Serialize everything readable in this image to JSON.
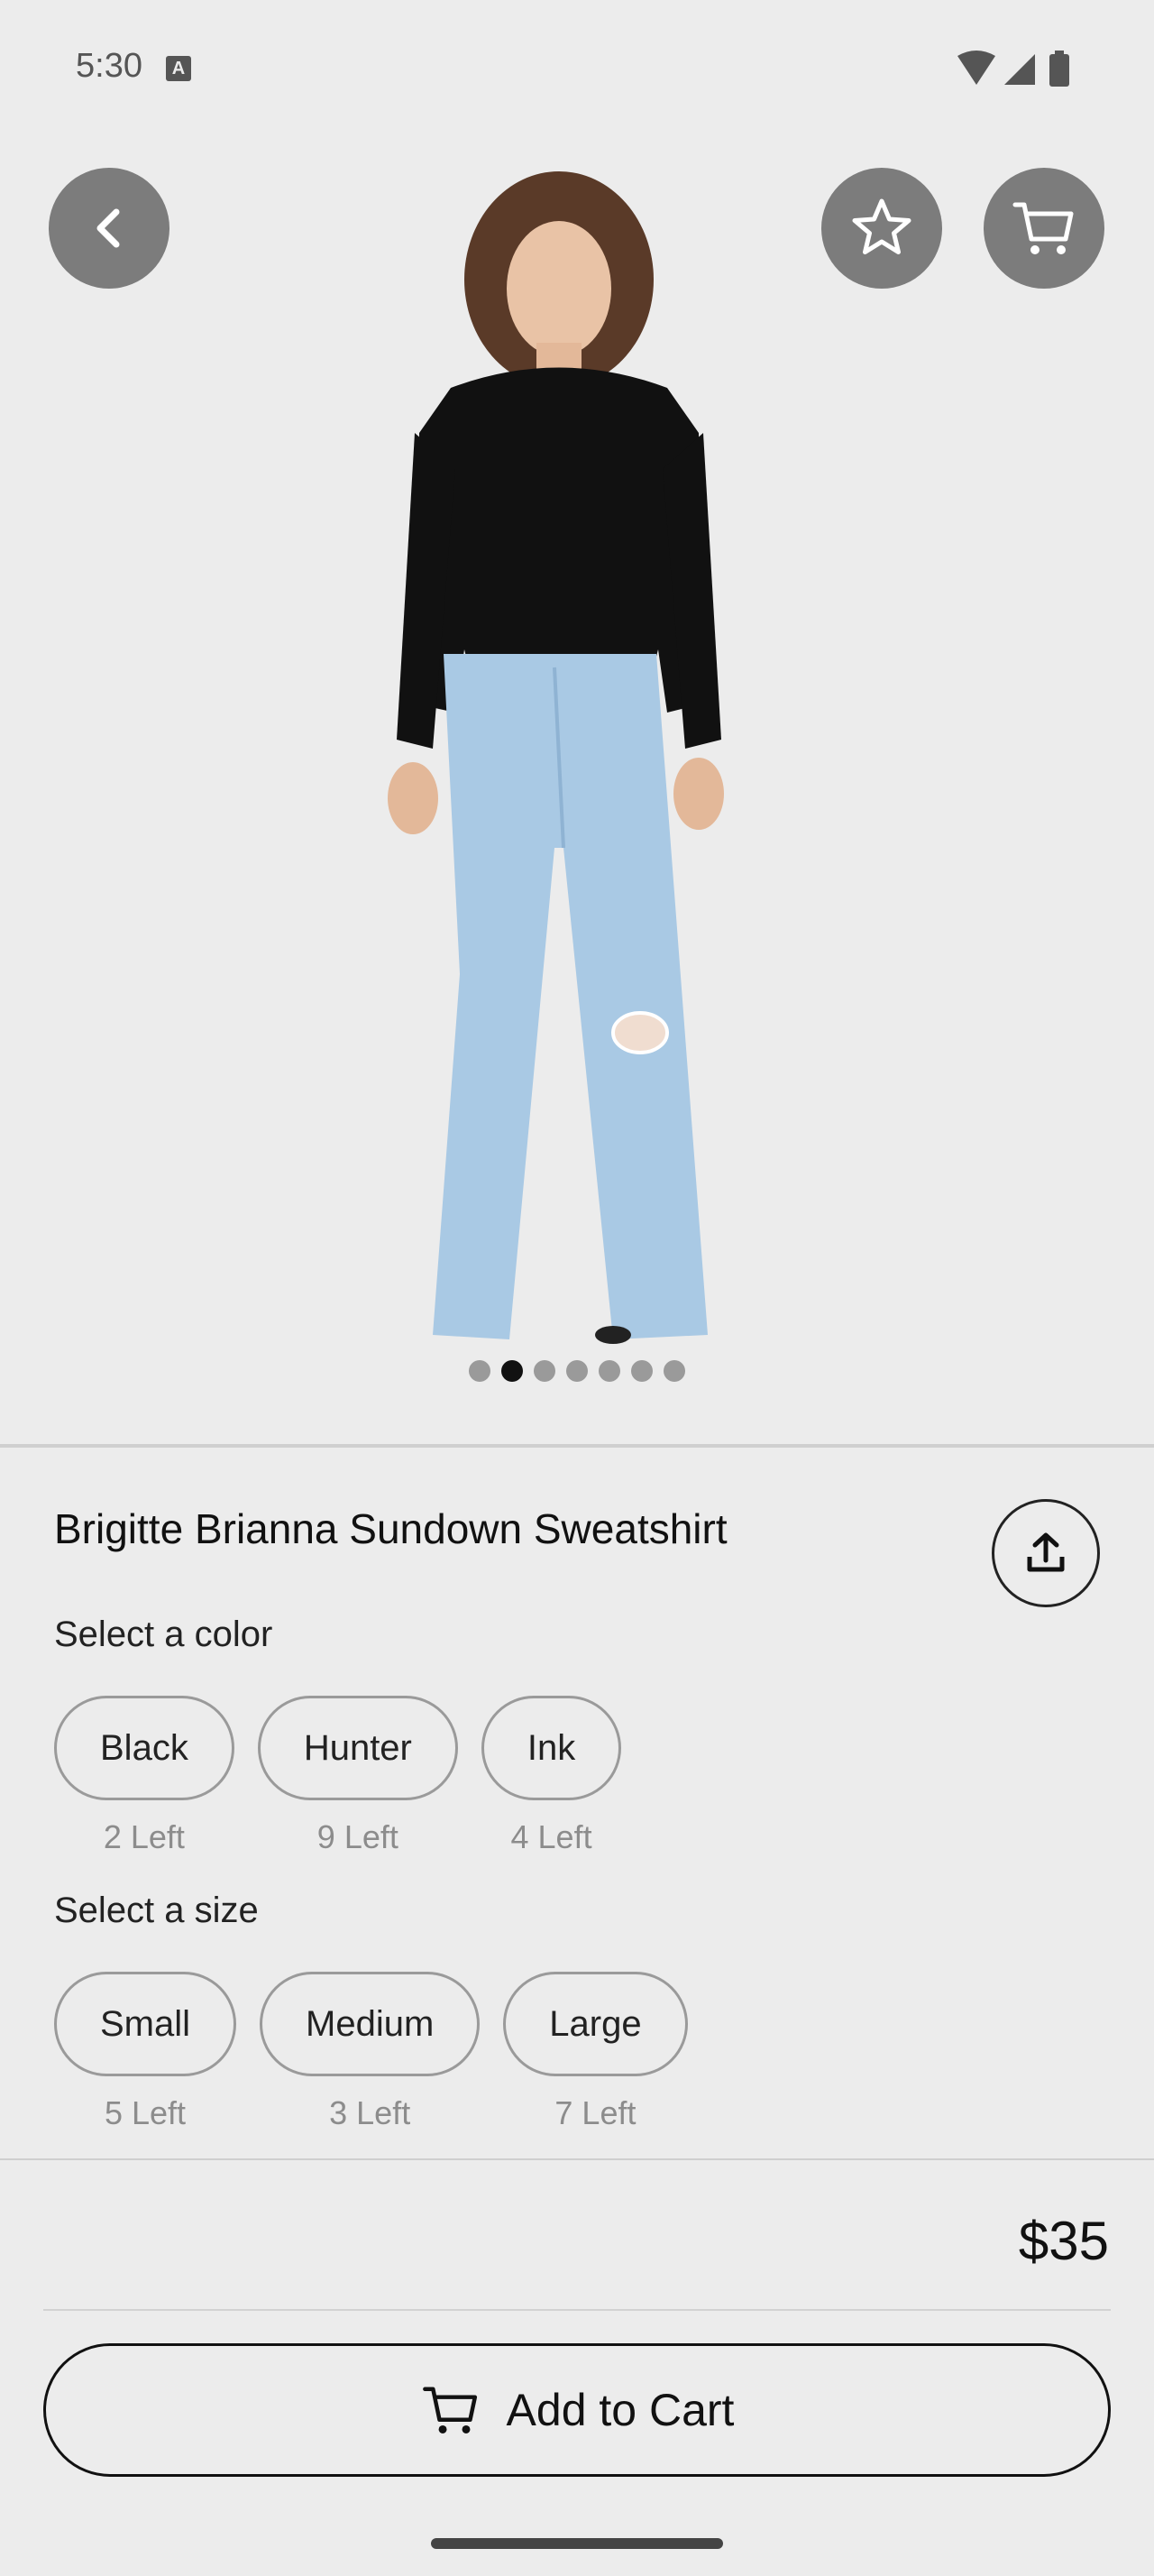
{
  "status_bar": {
    "time": "5:30",
    "notification_icon": "A"
  },
  "product": {
    "title": "Brigitte Brianna Sundown Sweatshirt",
    "price": "$35",
    "image_count": 7,
    "active_image": 2
  },
  "colors": {
    "label": "Select a color",
    "options": [
      {
        "name": "Black",
        "stock": "2 Left"
      },
      {
        "name": "Hunter",
        "stock": "9 Left"
      },
      {
        "name": "Ink",
        "stock": "4 Left"
      }
    ]
  },
  "sizes": {
    "label": "Select a size",
    "options": [
      {
        "name": "Small",
        "stock": "5 Left"
      },
      {
        "name": "Medium",
        "stock": "3 Left"
      },
      {
        "name": "Large",
        "stock": "7 Left"
      }
    ]
  },
  "actions": {
    "add_to_cart": "Add to Cart"
  },
  "icons": {
    "back": "chevron-left-icon",
    "favorite": "star-icon",
    "cart": "cart-icon",
    "share": "share-icon"
  },
  "colors_ui": {
    "background": "#ececec",
    "overlay_button": "#7c7c7c",
    "active_dot": "#111111",
    "inactive_dot": "#9a9a9a"
  }
}
